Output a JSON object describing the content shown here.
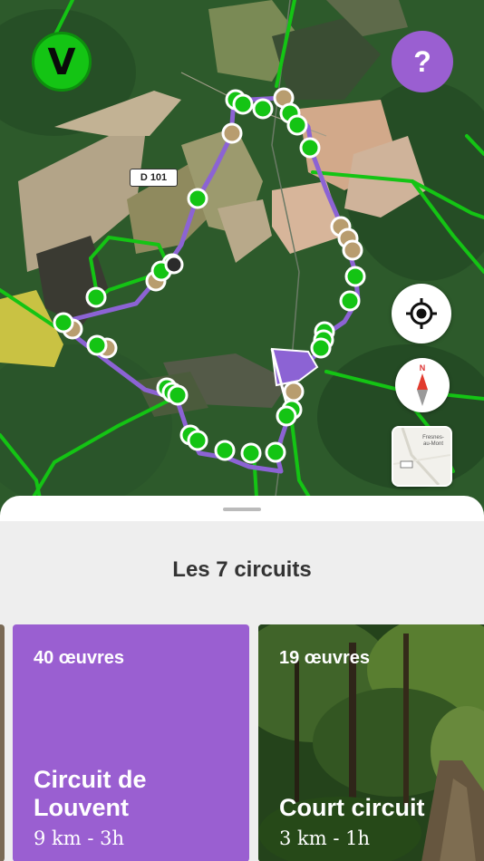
{
  "top_buttons": {
    "logo_glyph": "V",
    "help_glyph": "?"
  },
  "map": {
    "road_label": "D 101",
    "layer_thumb_label": "Fresnes-au-Mont"
  },
  "sheet": {
    "title": "Les 7 circuits"
  },
  "circuits": [
    {
      "count": "40 œuvres",
      "name_line1": "Circuit de",
      "name_line2": "Louvent",
      "meta": "9 km - 3h",
      "color": "#9a5fd1"
    },
    {
      "count": "19 œuvres",
      "name_line1": "",
      "name_line2": "Court circuit",
      "meta": "3 km - 1h",
      "color": "#2f5a23"
    }
  ],
  "colors": {
    "accent_purple": "#9a5fd1",
    "route_purple": "#8c63d4",
    "trail_green": "#14c414",
    "poi_tan": "#b89d6f"
  },
  "icons": [
    "logo-icon",
    "help-icon",
    "my-location-icon",
    "compass-icon",
    "map-layers-icon",
    "finish-flag-icon"
  ]
}
